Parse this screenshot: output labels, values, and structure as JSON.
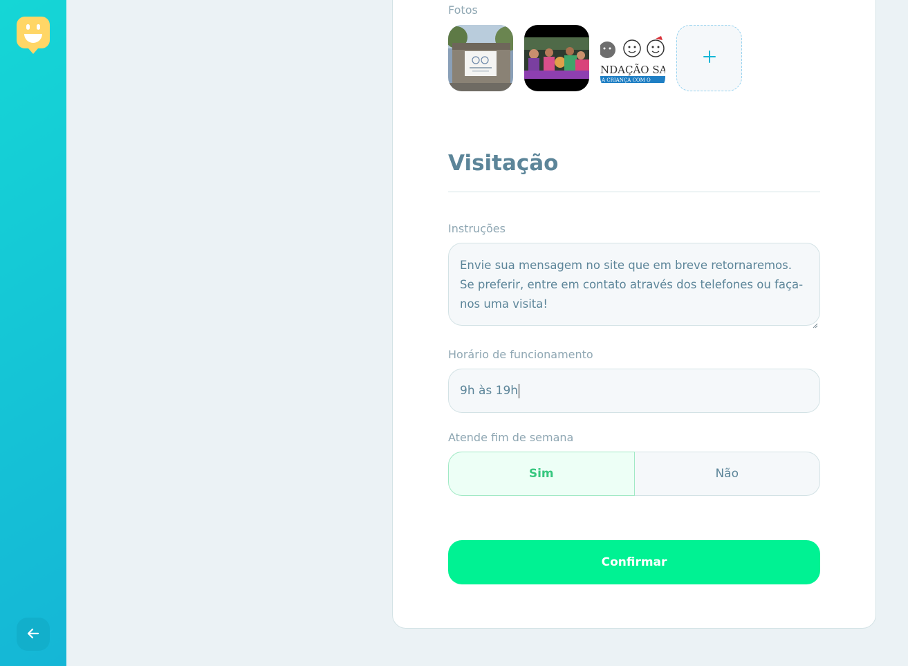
{
  "colors": {
    "sidebar_gradient_start": "#15D6D6",
    "sidebar_gradient_end": "#15B6D6",
    "accent_green": "#00F293",
    "title_blue": "#5C8599",
    "label_gray": "#8FA7B3",
    "logo_yellow": "#FFD666"
  },
  "sidebar": {
    "logo_icon": "happy-map-marker-icon",
    "back_icon": "arrow-left-icon"
  },
  "photos": {
    "label": "Fotos",
    "items": [
      {
        "icon": "orphanage-building-photo"
      },
      {
        "icon": "children-group-photo"
      },
      {
        "icon": "foundation-logo-photo",
        "visible_text": "NDAÇÃO SA",
        "visible_subtext": "A CRIANÇA COM O"
      }
    ],
    "add_icon": "plus-icon",
    "add_symbol": "+"
  },
  "visitation": {
    "title": "Visitação",
    "instructions_label": "Instruções",
    "instructions_value": "Envie sua mensagem no site que em breve retornaremos. Se preferir, entre em contato através dos telefones ou faça-nos uma visita!",
    "hours_label": "Horário de funcionamento",
    "hours_value": "9h às 19h",
    "weekends_label": "Atende fim de semana",
    "weekends_yes": "Sim",
    "weekends_no": "Não",
    "weekends_selected": "Sim"
  },
  "actions": {
    "confirm_label": "Confirmar"
  }
}
